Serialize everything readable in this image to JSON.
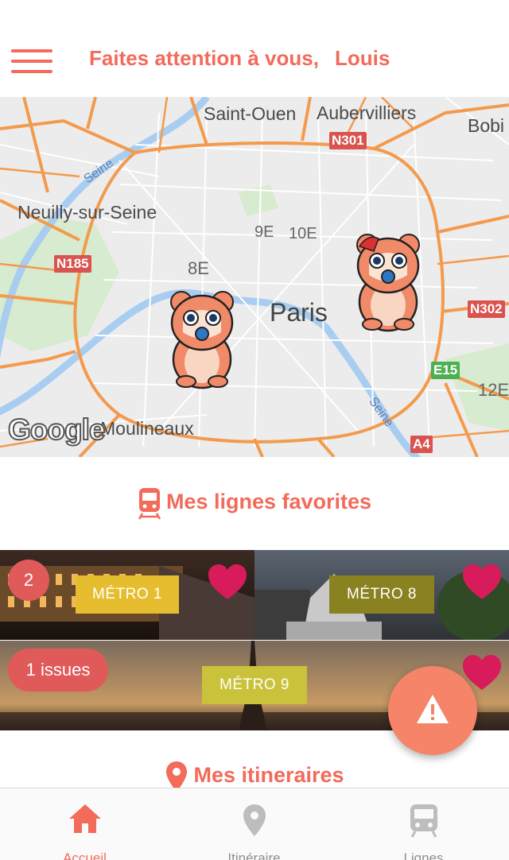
{
  "header": {
    "greeting": "Faites attention à vous,",
    "user_name": "Louis"
  },
  "map": {
    "labels": {
      "saint_ouen": "Saint-Ouen",
      "aubervilliers": "Aubervilliers",
      "bobigny": "Bobi",
      "neuilly": "Neuilly-sur-Seine",
      "seine_top": "Seine",
      "seine_bottom": "Seine",
      "arr_9": "9E",
      "arr_10": "10E",
      "arr_8": "8E",
      "paris": "Paris",
      "arr_12": "12E",
      "moulineaux": "Moulineaux"
    },
    "roads": {
      "n301": "N301",
      "n185": "N185",
      "n302": "N302",
      "e15": "E15",
      "a4": "A4"
    },
    "google": "Google"
  },
  "favorites": {
    "title": "Mes lignes favorites",
    "cards": [
      {
        "label": "MÉTRO 1",
        "color": "#e7bd30"
      },
      {
        "label": "MÉTRO 8",
        "color": "#8a8220"
      },
      {
        "label": "MÉTRO 9",
        "color": "#c9c23a"
      }
    ],
    "badge_count": "2",
    "badge_issues": "1 issues"
  },
  "itineraries": {
    "title": "Mes itineraires"
  },
  "tabs": [
    {
      "label": "Accueil",
      "icon": "home-icon"
    },
    {
      "label": "Itinéraire",
      "icon": "location-pin-icon"
    },
    {
      "label": "Lignes",
      "icon": "train-icon"
    }
  ],
  "colors": {
    "accent": "#f26b5b",
    "heart": "#d81b5a",
    "fab": "#f58468",
    "roads": "#f39a4d"
  }
}
